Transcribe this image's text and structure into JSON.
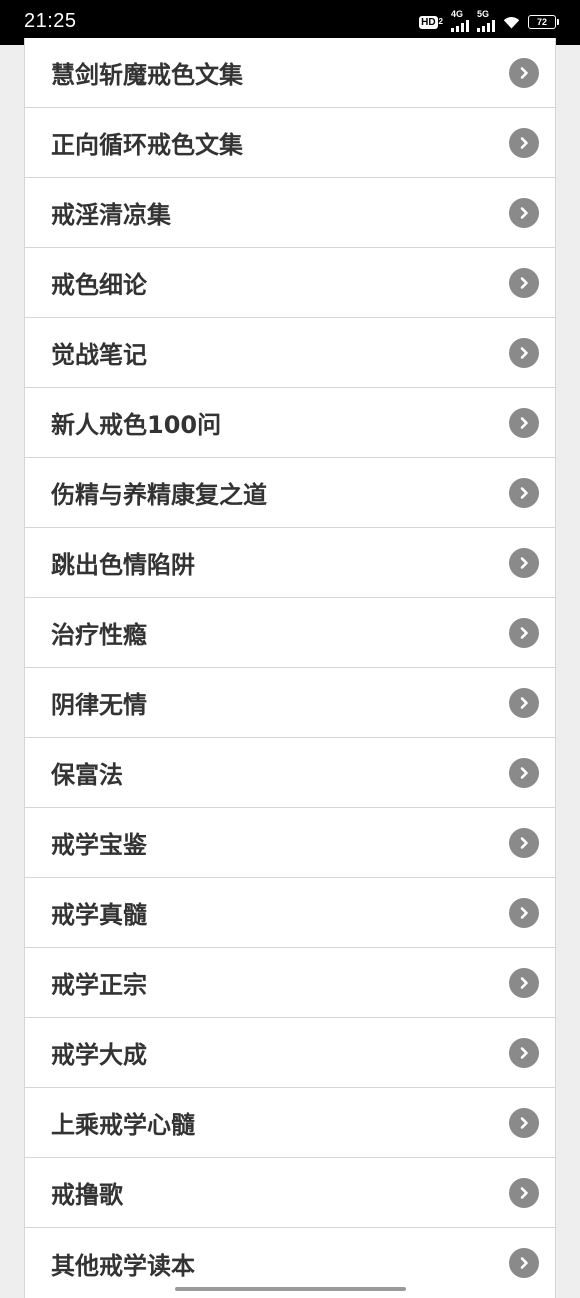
{
  "status_bar": {
    "time": "21:25",
    "hd_label": "HD",
    "hd_sub": "2",
    "network_1": "4G",
    "network_2": "5G",
    "battery": "72"
  },
  "list": {
    "items": [
      {
        "label": "慧剑斩魔戒色文集"
      },
      {
        "label": "正向循环戒色文集"
      },
      {
        "label": "戒淫清凉集"
      },
      {
        "label": "戒色细论"
      },
      {
        "label": "觉战笔记"
      },
      {
        "label": "新人戒色100问"
      },
      {
        "label": "伤精与养精康复之道"
      },
      {
        "label": "跳出色情陷阱"
      },
      {
        "label": "治疗性瘾"
      },
      {
        "label": "阴律无情"
      },
      {
        "label": "保富法"
      },
      {
        "label": "戒学宝鉴"
      },
      {
        "label": "戒学真髓"
      },
      {
        "label": "戒学正宗"
      },
      {
        "label": "戒学大成"
      },
      {
        "label": "上乘戒学心髓"
      },
      {
        "label": "戒撸歌"
      },
      {
        "label": "其他戒学读本"
      }
    ]
  },
  "icons": {
    "row_icon": "chevron-right-circle-icon"
  },
  "colors": {
    "status_bar_bg": "#000000",
    "page_bg": "#eeeeee",
    "row_bg": "#ffffff",
    "text": "#333333",
    "chevron_bg": "#8a8a8a",
    "divider": "#d6d6d6"
  }
}
